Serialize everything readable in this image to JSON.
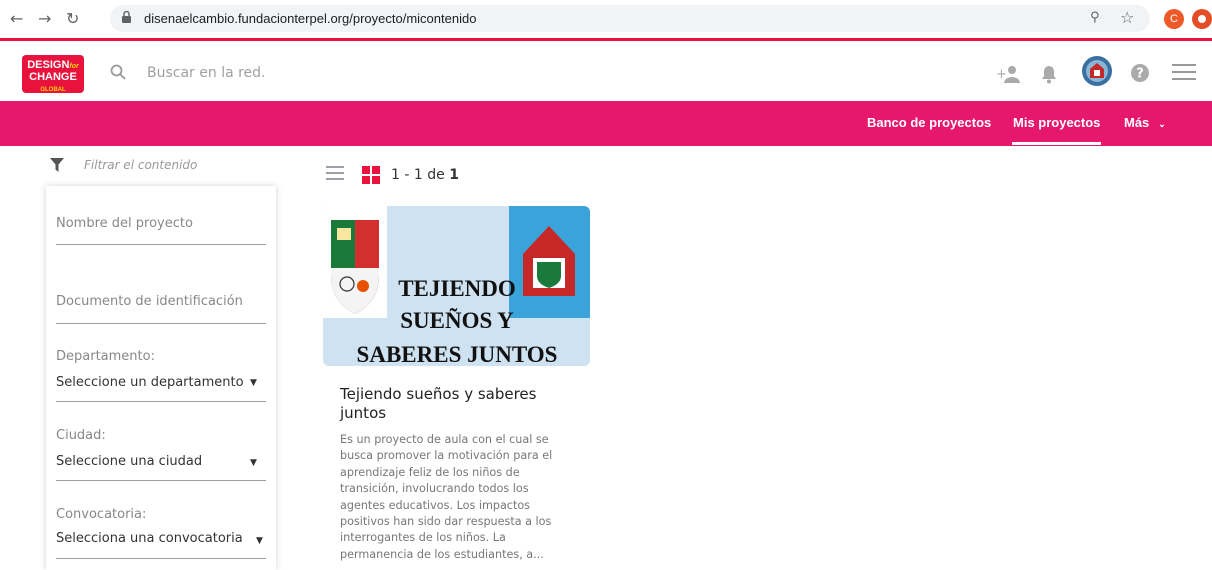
{
  "browser": {
    "url": "disenaelcambio.fundacionterpel.org/proyecto/micontenido",
    "profile_initial": "C",
    "accent": "#e8123c"
  },
  "header": {
    "logo_text_1": "DESIGN",
    "logo_text_for": "for",
    "logo_text_2": "CHANGE",
    "logo_text_3": "GLOBAL",
    "search_placeholder": "Buscar en la red."
  },
  "nav": {
    "items": [
      {
        "label": "Banco de proyectos"
      },
      {
        "label": "Mis proyectos"
      },
      {
        "label": "Más"
      }
    ],
    "color": "#e6186e"
  },
  "filter": {
    "title": "Filtrar el contenido",
    "project_name_placeholder": "Nombre del proyecto",
    "document_placeholder": "Documento de identificación",
    "department_label": "Departamento:",
    "department_value": "Seleccione un departamento",
    "city_label": "Ciudad:",
    "city_value": "Seleccione una ciudad",
    "call_label": "Convocatoria:",
    "call_value": "Selecciona una convocatoria"
  },
  "results": {
    "range": "1 - 1",
    "of_label": "de",
    "total": "1"
  },
  "card": {
    "image_text_1": "TEJIENDO",
    "image_text_2": "SUEÑOS Y",
    "image_text_3": "SABERES JUNTOS",
    "title": "Tejiendo sueños y saberes juntos",
    "description": "Es un proyecto de aula con el cual se busca promover la motivación para el aprendizaje feliz de los niños de transición, involucrando todos los agentes educativos. Los impactos positivos han sido dar respuesta a los interrogantes de los niños. La permanencia de los estudiantes, a..."
  }
}
